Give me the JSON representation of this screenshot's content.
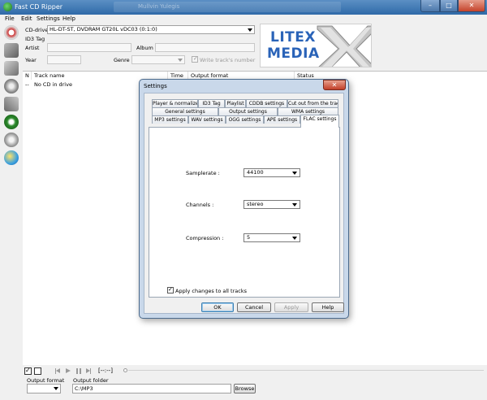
{
  "window": {
    "title": "Fast CD Ripper",
    "background_title": "Mullvin Yulegis"
  },
  "menu": [
    "File",
    "Edit",
    "Settings",
    "Help"
  ],
  "header": {
    "cd_drive_label": "CD-drive",
    "cd_drive_value": "HL-DT-ST, DVDRAM GT20L    vDC03 (0:1:0)",
    "id3_tag_label": "ID3 Tag",
    "artist_label": "Artist",
    "album_label": "Album",
    "year_label": "Year",
    "genre_label": "Genre",
    "write_track_number_label": "Write track's number"
  },
  "logo": {
    "line1": "LITEX",
    "line2": "MEDIA"
  },
  "tracklist": {
    "columns": [
      "N",
      "Track name",
      "Time",
      "Output format",
      "Status"
    ],
    "rows": [
      {
        "n": "--",
        "name": "No CD in drive"
      }
    ]
  },
  "bottom": {
    "output_format_label": "Output format",
    "output_folder_label": "Output folder",
    "output_folder_value": "C:\\MP3",
    "browse_label": "Browse",
    "time_display": "[--:--]"
  },
  "dialog": {
    "title": "Settings",
    "tabs_row1": [
      "Player & normalize",
      "ID3 Tag",
      "Playlist",
      "CDDB settings",
      "Cut out from the track"
    ],
    "tabs_row2": [
      "General settings",
      "Output settings",
      "WMA settings"
    ],
    "tabs_row3": [
      "MP3 settings",
      "WAV settings",
      "OGG settings",
      "APE settings",
      "FLAC settings"
    ],
    "active_tab": "FLAC settings",
    "samplerate_label": "Samplerate :",
    "samplerate_value": "44100",
    "channels_label": "Channels :",
    "channels_value": "stereo",
    "compression_label": "Compression :",
    "compression_value": "5",
    "apply_all_label": "Apply changes to all tracks",
    "apply_all_checked": true,
    "ok_label": "OK",
    "cancel_label": "Cancel",
    "apply_label": "Apply",
    "help_label": "Help"
  },
  "colors": {
    "title_bar": "#2f6aa8",
    "dialog_frame": "#c9d8ea",
    "logo_blue": "#2a63b8"
  }
}
